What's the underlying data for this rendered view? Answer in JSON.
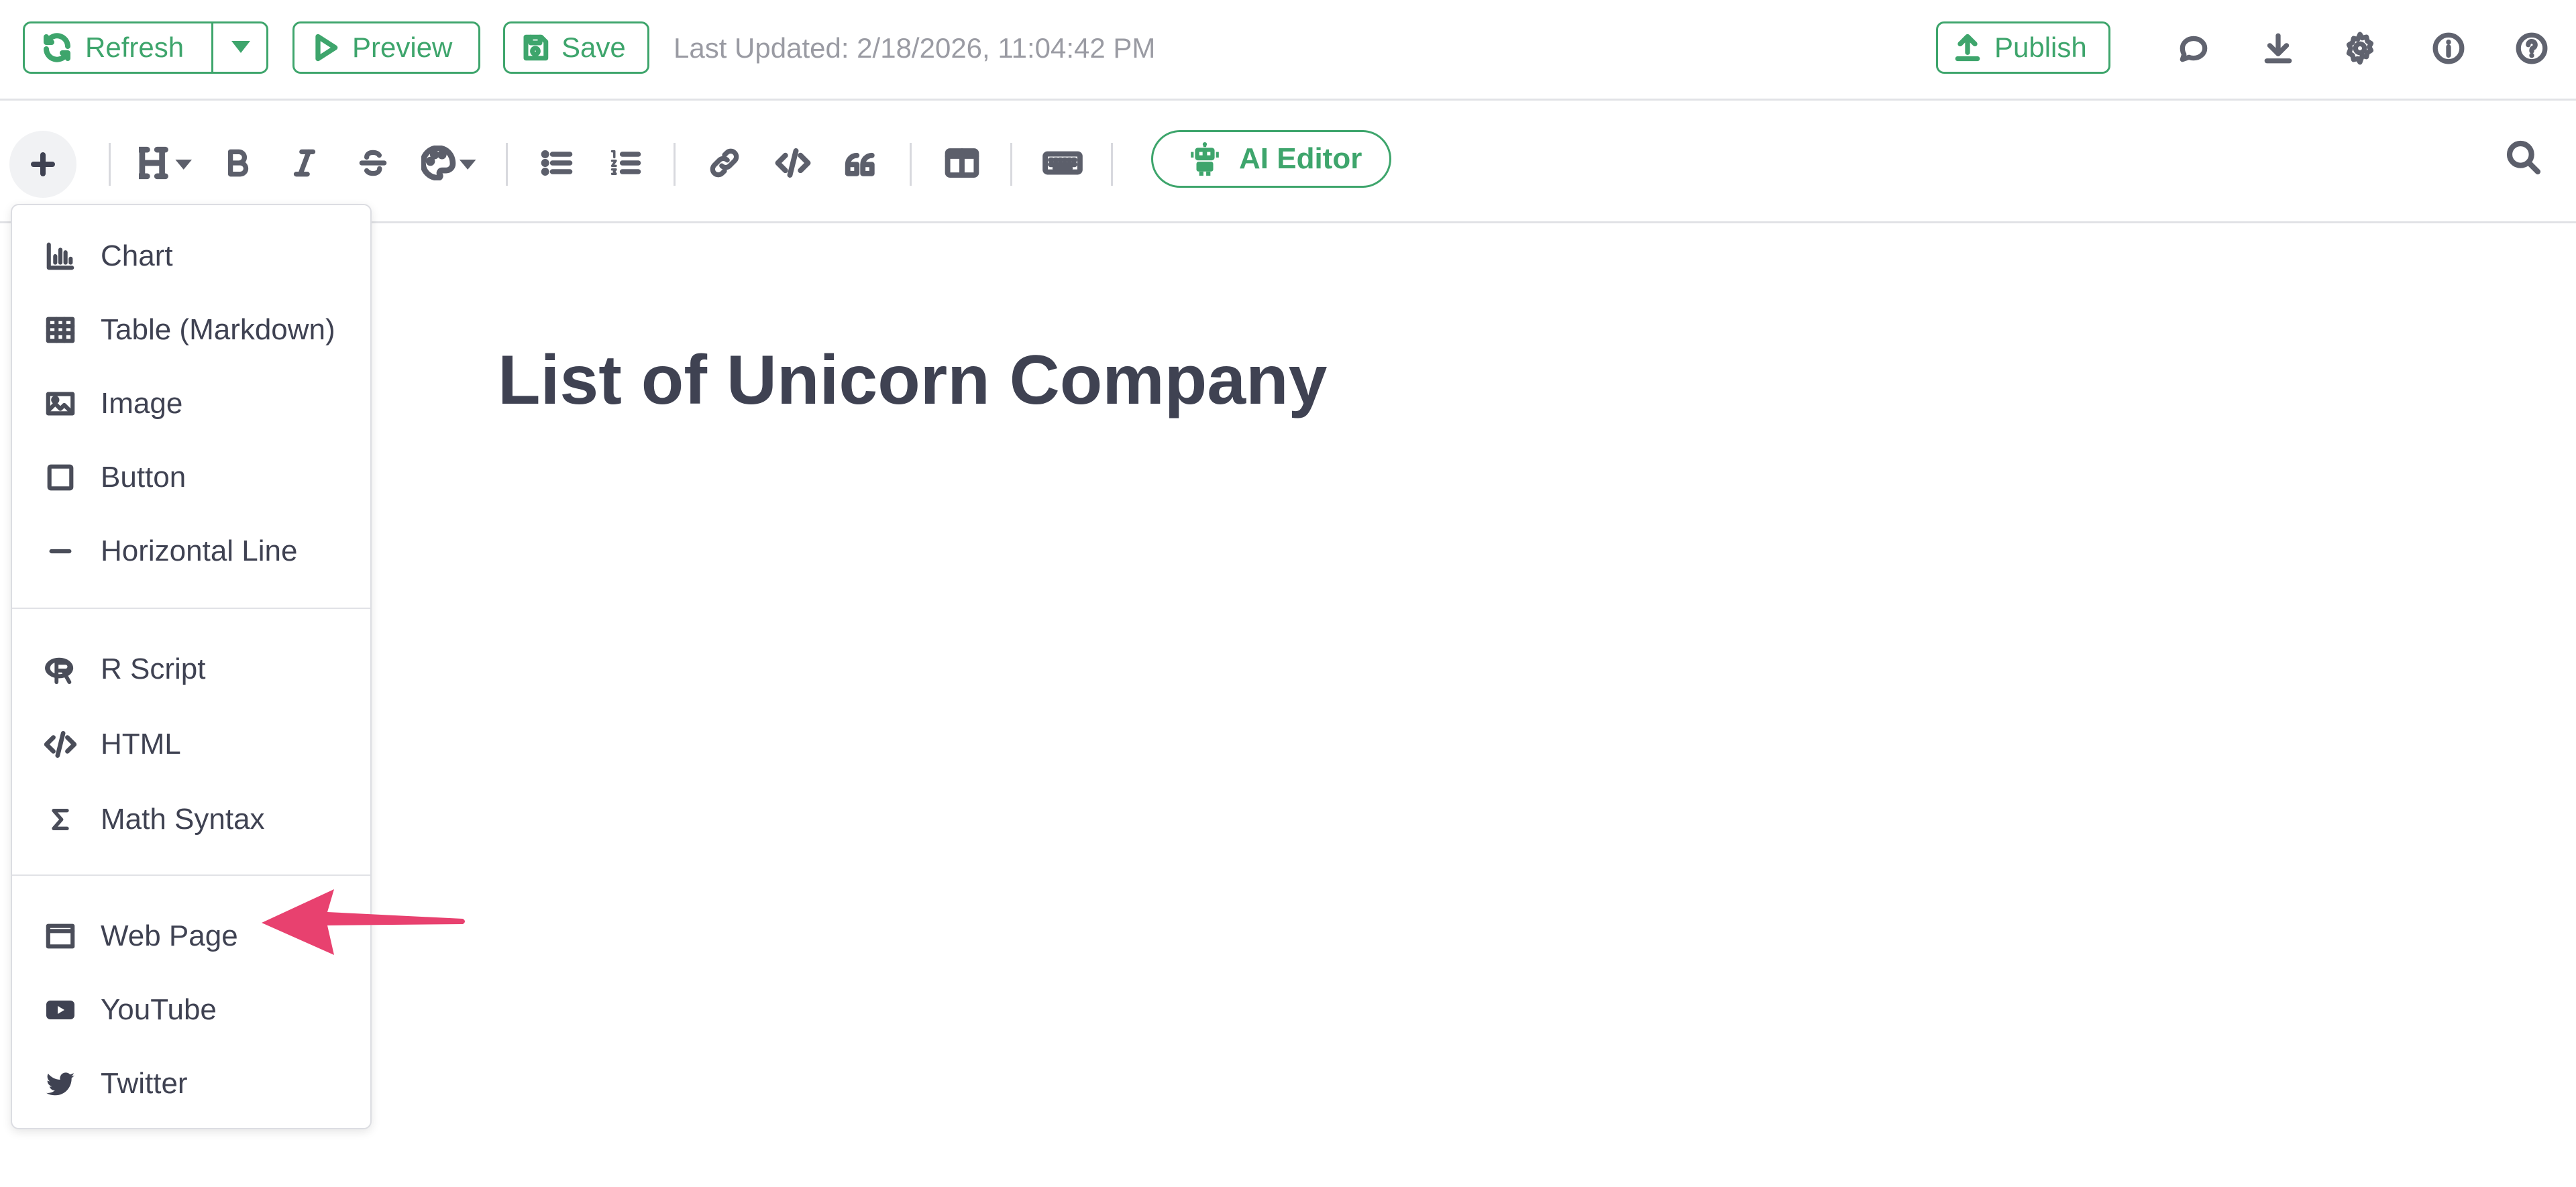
{
  "header": {
    "refresh_label": "Refresh",
    "preview_label": "Preview",
    "save_label": "Save",
    "last_updated": "Last Updated: 2/18/2026, 11:04:42 PM",
    "publish_label": "Publish",
    "icons": [
      "comment-icon",
      "download-icon",
      "gear-icon",
      "info-icon",
      "help-icon"
    ]
  },
  "toolbar": {
    "ai_editor_label": "AI Editor",
    "icons": [
      "plus-icon",
      "heading-icon",
      "bold-icon",
      "italic-icon",
      "strikethrough-icon",
      "palette-icon",
      "bullet-list-icon",
      "numbered-list-icon",
      "link-icon",
      "code-icon",
      "quote-icon",
      "split-view-icon",
      "keyboard-icon",
      "robot-icon",
      "search-icon"
    ]
  },
  "document": {
    "title": "List of Unicorn Company"
  },
  "insert_menu": {
    "groups": [
      [
        {
          "label": "Chart",
          "icon": "chart-icon"
        },
        {
          "label": "Table (Markdown)",
          "icon": "table-icon"
        },
        {
          "label": "Image",
          "icon": "image-icon"
        },
        {
          "label": "Button",
          "icon": "button-icon"
        },
        {
          "label": "Horizontal Line",
          "icon": "horizontal-line-icon"
        }
      ],
      [
        {
          "label": "R Script",
          "icon": "r-logo-icon"
        },
        {
          "label": "HTML",
          "icon": "code-icon"
        },
        {
          "label": "Math Syntax",
          "icon": "sigma-icon"
        }
      ],
      [
        {
          "label": "Web Page",
          "icon": "browser-window-icon"
        },
        {
          "label": "YouTube",
          "icon": "youtube-icon"
        },
        {
          "label": "Twitter",
          "icon": "twitter-icon"
        }
      ]
    ]
  },
  "colors": {
    "accent": "#3ea56c",
    "annotation_arrow": "#e8416f",
    "text": "#3f4252",
    "muted": "#9a9ba3"
  }
}
